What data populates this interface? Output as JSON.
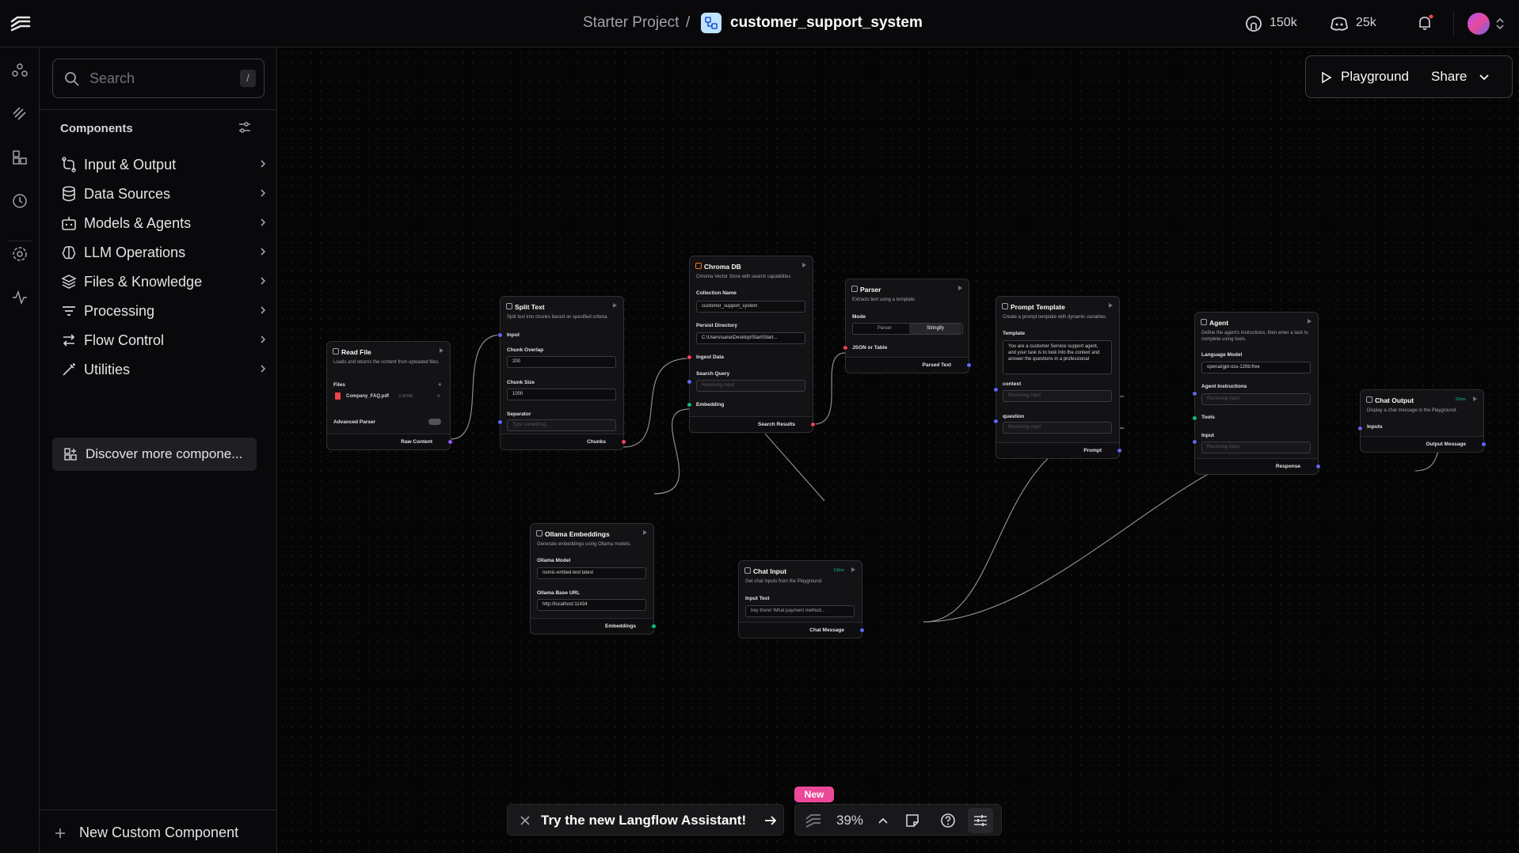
{
  "header": {
    "project": "Starter Project",
    "separator": "/",
    "flow_name": "customer_support_system",
    "github_count": "150k",
    "discord_count": "25k"
  },
  "sidebar": {
    "search_placeholder": "Search",
    "search_shortcut": "/",
    "components_title": "Components",
    "categories": [
      {
        "label": "Input & Output",
        "icon": "input-output-icon"
      },
      {
        "label": "Data Sources",
        "icon": "database-icon"
      },
      {
        "label": "Models & Agents",
        "icon": "bot-icon"
      },
      {
        "label": "LLM Operations",
        "icon": "brain-icon"
      },
      {
        "label": "Files & Knowledge",
        "icon": "layers-icon"
      },
      {
        "label": "Processing",
        "icon": "filter-icon"
      },
      {
        "label": "Flow Control",
        "icon": "arrows-icon"
      },
      {
        "label": "Utilities",
        "icon": "wand-icon"
      }
    ],
    "discover_label": "Discover more compone...",
    "new_custom_label": "New Custom Component"
  },
  "toolbar": {
    "playground_label": "Playground",
    "share_label": "Share"
  },
  "nodes": {
    "read_file": {
      "title": "Read File",
      "desc": "Loads and returns the content from uploaded files.",
      "files_label": "Files",
      "file_name": "Company_FAQ.pdf",
      "file_size": "3.39 KB",
      "advanced_parser_label": "Advanced Parser",
      "output": "Raw Content"
    },
    "split_text": {
      "title": "Split Text",
      "desc": "Split text into chunks based on specified criteria.",
      "input_label": "Input",
      "chunk_overlap_label": "Chunk Overlap",
      "chunk_overlap": "200",
      "chunk_size_label": "Chunk Size",
      "chunk_size": "1000",
      "separator_label": "Separator",
      "separator_placeholder": "Type something...",
      "output": "Chunks"
    },
    "chroma": {
      "title": "Chroma DB",
      "desc": "Chroma Vector Store with search capabilities",
      "collection_label": "Collection Name",
      "collection": "customer_support_system",
      "persist_label": "Persist Directory",
      "persist": "C:\\Users\\sana\\Desktop\\Start\\Start...",
      "ingest_label": "Ingest Data",
      "search_query_label": "Search Query",
      "search_query_placeholder": "Receiving input",
      "embedding_label": "Embedding",
      "output": "Search Results"
    },
    "parser": {
      "title": "Parser",
      "desc": "Extracts text using a template.",
      "mode_label": "Mode",
      "mode_options": [
        "Parser",
        "Stringify"
      ],
      "json_label": "JSON or Table",
      "output": "Parsed Text"
    },
    "prompt": {
      "title": "Prompt Template",
      "desc": "Create a prompt template with dynamic variables.",
      "template_label": "Template",
      "template_text": "You are a customer Service support agent, and your task is to look into the context and answer the questions in a professional",
      "context_label": "context",
      "context_placeholder": "Receiving input",
      "question_label": "question",
      "question_placeholder": "Receiving input",
      "output": "Prompt"
    },
    "agent": {
      "title": "Agent",
      "desc": "Define the agent's instructions, then enter a task to complete using tools.",
      "model_label": "Language Model",
      "model": "openai/gpt-oss-120b:free",
      "instructions_label": "Agent Instructions",
      "instructions_placeholder": "Receiving input",
      "tools_label": "Tools",
      "input_label": "Input",
      "input_placeholder": "Receiving input",
      "output": "Response"
    },
    "chat_output": {
      "title": "Chat Output",
      "badge": "29ms",
      "desc": "Display a chat message in the Playground.",
      "inputs_label": "Inputs",
      "output": "Output Message"
    },
    "ollama": {
      "title": "Ollama Embeddings",
      "desc": "Generate embeddings using Ollama models.",
      "model_label": "Ollama Model",
      "model": "nomic-embed-text:latest",
      "url_label": "Ollama Base URL",
      "url": "http://localhost:11434",
      "output": "Embeddings"
    },
    "chat_input": {
      "title": "Chat Input",
      "badge": "13ms",
      "desc": "Get chat inputs from the Playground.",
      "input_text_label": "Input Text",
      "input_text": "hey there! What payment method...",
      "output": "Chat Message"
    }
  },
  "bottom": {
    "assistant_label": "Try the new Langflow Assistant!",
    "new_badge": "New",
    "zoom": "39%"
  }
}
